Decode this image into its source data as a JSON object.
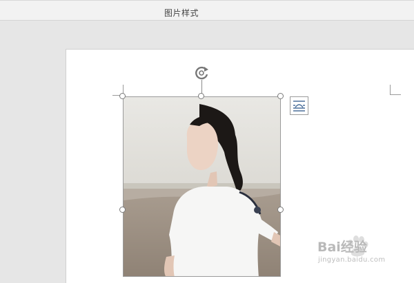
{
  "ribbon": {
    "tab_title": "图片样式"
  },
  "image": {
    "selected": true
  },
  "icons": {
    "rotate": "rotate-icon",
    "layout_options": "layout-options-icon"
  },
  "watermark": {
    "brand": "Bai经验",
    "url": "jingyan.baidu.com"
  },
  "colors": {
    "ribbon_bg": "#f2f2f2",
    "workspace_bg": "#e6e6e6",
    "page_bg": "#ffffff",
    "handle_stroke": "#7a7a7a"
  }
}
